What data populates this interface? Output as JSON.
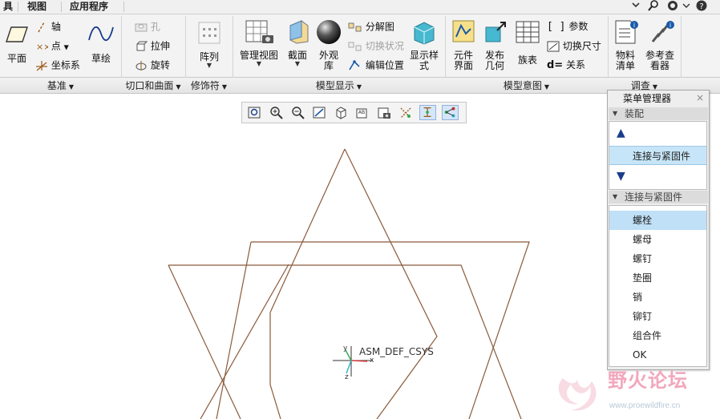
{
  "tabs": [
    {
      "label": "具",
      "selected": false
    },
    {
      "label": "视图",
      "selected": false
    },
    {
      "label": "应用程序",
      "selected": false
    }
  ],
  "ribbon": {
    "datum": {
      "plane": "平面",
      "axis": "轴",
      "point": "点",
      "csys": "坐标系",
      "sketch": "草绘"
    },
    "cut": {
      "hole": "孔",
      "extrude": "拉伸",
      "revolve": "旋转"
    },
    "pattern": {
      "pattern": "阵列"
    },
    "display": {
      "view_manager": "管理视图",
      "section": "截面",
      "appearance": "外观",
      "appearance2": "库",
      "explode": "分解图",
      "toggle_status": "切换状况",
      "edit_position": "编辑位置",
      "display_style": "显示样",
      "display_style2": "式"
    },
    "intent": {
      "component_interface": "元件",
      "component_interface2": "界面",
      "publish_geom": "发布",
      "publish_geom2": "几何",
      "family_table": "族表",
      "parameters": "参数",
      "switch_dims": "切换尺寸",
      "relations": "关系"
    },
    "investigate": {
      "bom": "物料",
      "bom2": "清单",
      "ref_viewer": "参考查",
      "ref_viewer2": "看器"
    }
  },
  "groups": {
    "datum": "基准",
    "cut_surface": "切口和曲面",
    "modifier": "修饰符",
    "model_display": "模型显示",
    "model_intent": "模型意图",
    "investigate": "调查"
  },
  "canvas": {
    "csys_label": "ASM_DEF_CSYS",
    "axis_x": "x",
    "axis_y": "y",
    "axis_z": "z"
  },
  "menu_manager": {
    "title": "菜单管理器",
    "close": "×",
    "assembly_section": "装配",
    "assembly_selected": "连接与紧固件",
    "fastener_section": "连接与紧固件",
    "items": [
      "螺栓",
      "螺母",
      "螺钉",
      "垫圈",
      "销",
      "铆钉",
      "组合件",
      "OK"
    ],
    "highlighted_index": 0
  },
  "watermark": {
    "text": "野火论坛",
    "url": "www.proewildfire.cn"
  },
  "colors": {
    "geometry": "#8a5a3a",
    "highlight": "#bfe0f6",
    "accent_blue": "#1a5aa8"
  }
}
